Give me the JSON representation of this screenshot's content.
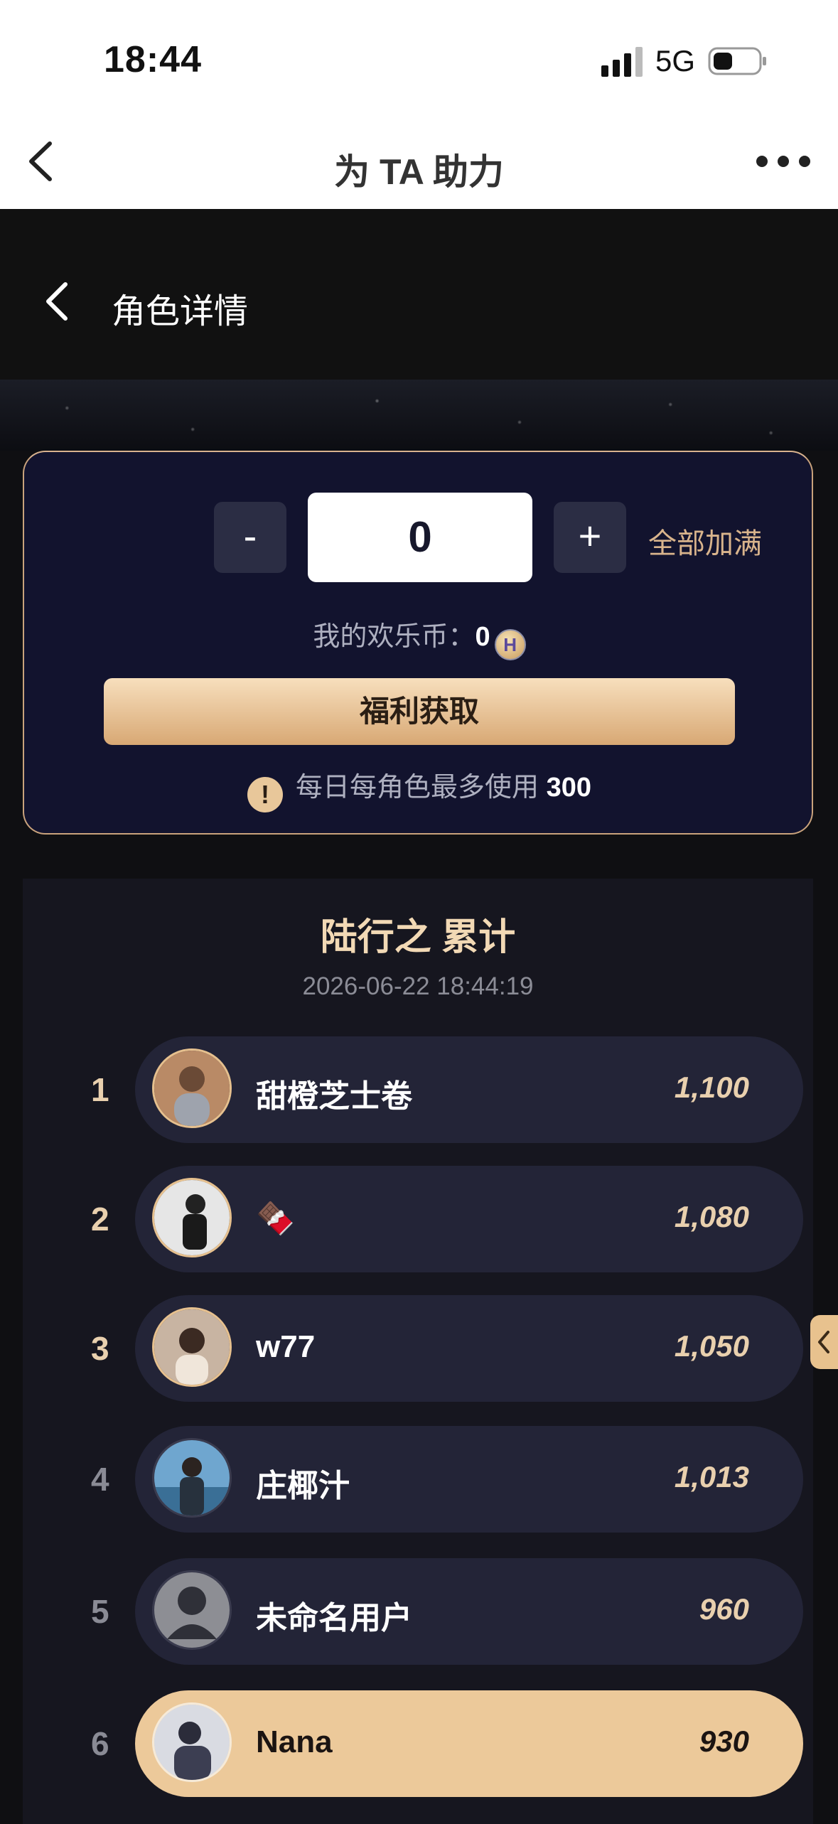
{
  "status_bar": {
    "time": "18:44",
    "network": "5G"
  },
  "navbar": {
    "title": "为 TA 助力"
  },
  "header": {
    "title": "角色详情"
  },
  "support_card": {
    "minus_label": "-",
    "plus_label": "+",
    "quantity": "0",
    "fill_all_label": "全部加满",
    "coins_label": "我的欢乐币：",
    "coins_value": "0",
    "coin_icon_letter": "H",
    "bonus_button": "福利获取",
    "notice_text": "每日每角色最多使用",
    "notice_limit": "300"
  },
  "ranking": {
    "title": "陆行之 累计",
    "timestamp": "2026-06-22 18:44:19",
    "rows": [
      {
        "rank": "1",
        "name": "甜橙芝士卷",
        "score": "1,100",
        "avatar_color": "#b98a66"
      },
      {
        "rank": "2",
        "name": "🍫",
        "score": "1,080",
        "avatar_color": "#d9d9d9"
      },
      {
        "rank": "3",
        "name": "w77",
        "score": "1,050",
        "avatar_color": "#9a7b68"
      },
      {
        "rank": "4",
        "name": "庄椰汁",
        "score": "1,013",
        "avatar_color": "#4f89b3"
      },
      {
        "rank": "5",
        "name": "未命名用户",
        "score": "960",
        "avatar_color": "#8d8e94"
      },
      {
        "rank": "6",
        "name": "Nana",
        "score": "930",
        "avatar_color": "#5d5f73"
      }
    ]
  }
}
